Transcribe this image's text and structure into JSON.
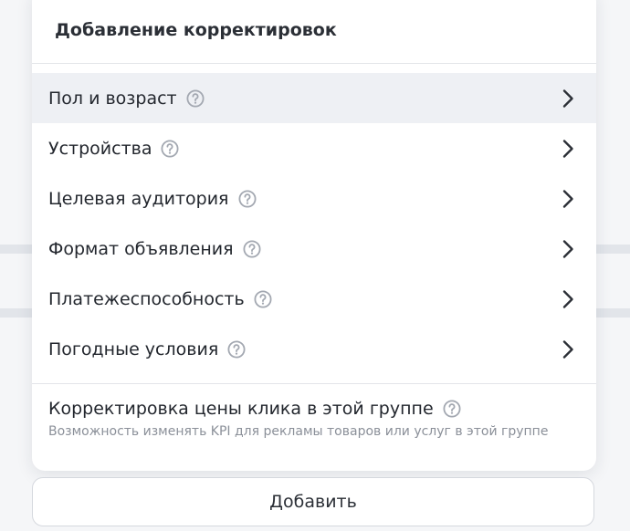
{
  "popup": {
    "title": "Добавление корректировок"
  },
  "menu": {
    "items": [
      {
        "label": "Пол и возраст",
        "icon": "help-circle-icon",
        "chevron": "chevron-right-icon",
        "active": true
      },
      {
        "label": "Устройства",
        "icon": "help-circle-icon",
        "chevron": "chevron-right-icon",
        "active": false
      },
      {
        "label": "Целевая аудитория",
        "icon": "help-circle-icon",
        "chevron": "chevron-right-icon",
        "active": false
      },
      {
        "label": "Формат объявления",
        "icon": "help-circle-icon",
        "chevron": "chevron-right-icon",
        "active": false
      },
      {
        "label": "Платежеспособность",
        "icon": "help-circle-icon",
        "chevron": "chevron-right-icon",
        "active": false
      },
      {
        "label": "Погодные условия",
        "icon": "help-circle-icon",
        "chevron": "chevron-right-icon",
        "active": false
      }
    ]
  },
  "bid_adjustment": {
    "title": "Корректировка цены клика в этой группе",
    "description": "Возможность изменять KPI для рекламы товаров или услуг в этой группе",
    "icon": "help-circle-icon"
  },
  "actions": {
    "add_label": "Добавить"
  },
  "colors": {
    "active_row": "#eef0f4",
    "icon_gray": "#a3a8b1",
    "text": "#23272e",
    "muted_text": "#8b9099",
    "divider": "#e3e5e9"
  }
}
